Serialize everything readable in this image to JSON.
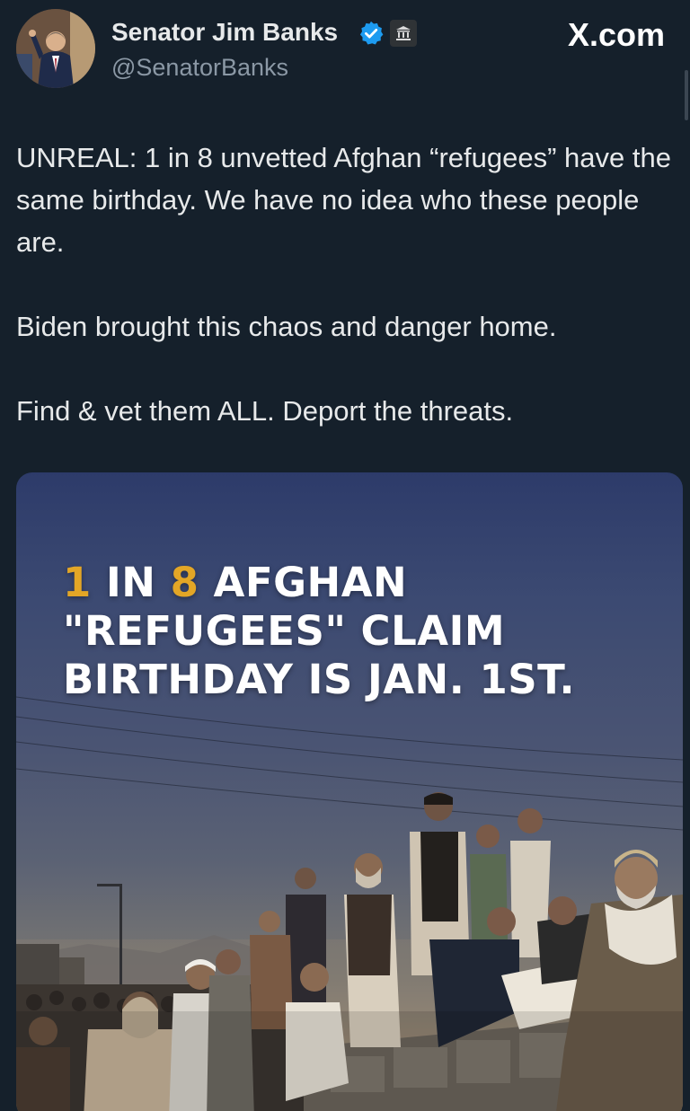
{
  "post": {
    "author": {
      "name": "Senator Jim Banks",
      "handle": "@SenatorBanks",
      "verified": true,
      "verified_color": "#1d9bf0",
      "affiliation_badge_icon": "government-building-icon"
    },
    "brand": "X.com",
    "text": {
      "line1": "UNREAL: 1 in 8 unvetted Afghan “refugees” have the same birthday. We have no idea who these people are.",
      "line2": "Biden brought this chaos and danger home.",
      "line3": "Find & vet them ALL. Deport the threats."
    },
    "media": {
      "headline": {
        "num1": "1",
        "part1": " IN ",
        "num2": "8",
        "part2": " AFGHAN \"REFUGEES\" CLAIM BIRTHDAY IS JAN. 1ST."
      },
      "highlight_color": "#e3a626"
    }
  }
}
